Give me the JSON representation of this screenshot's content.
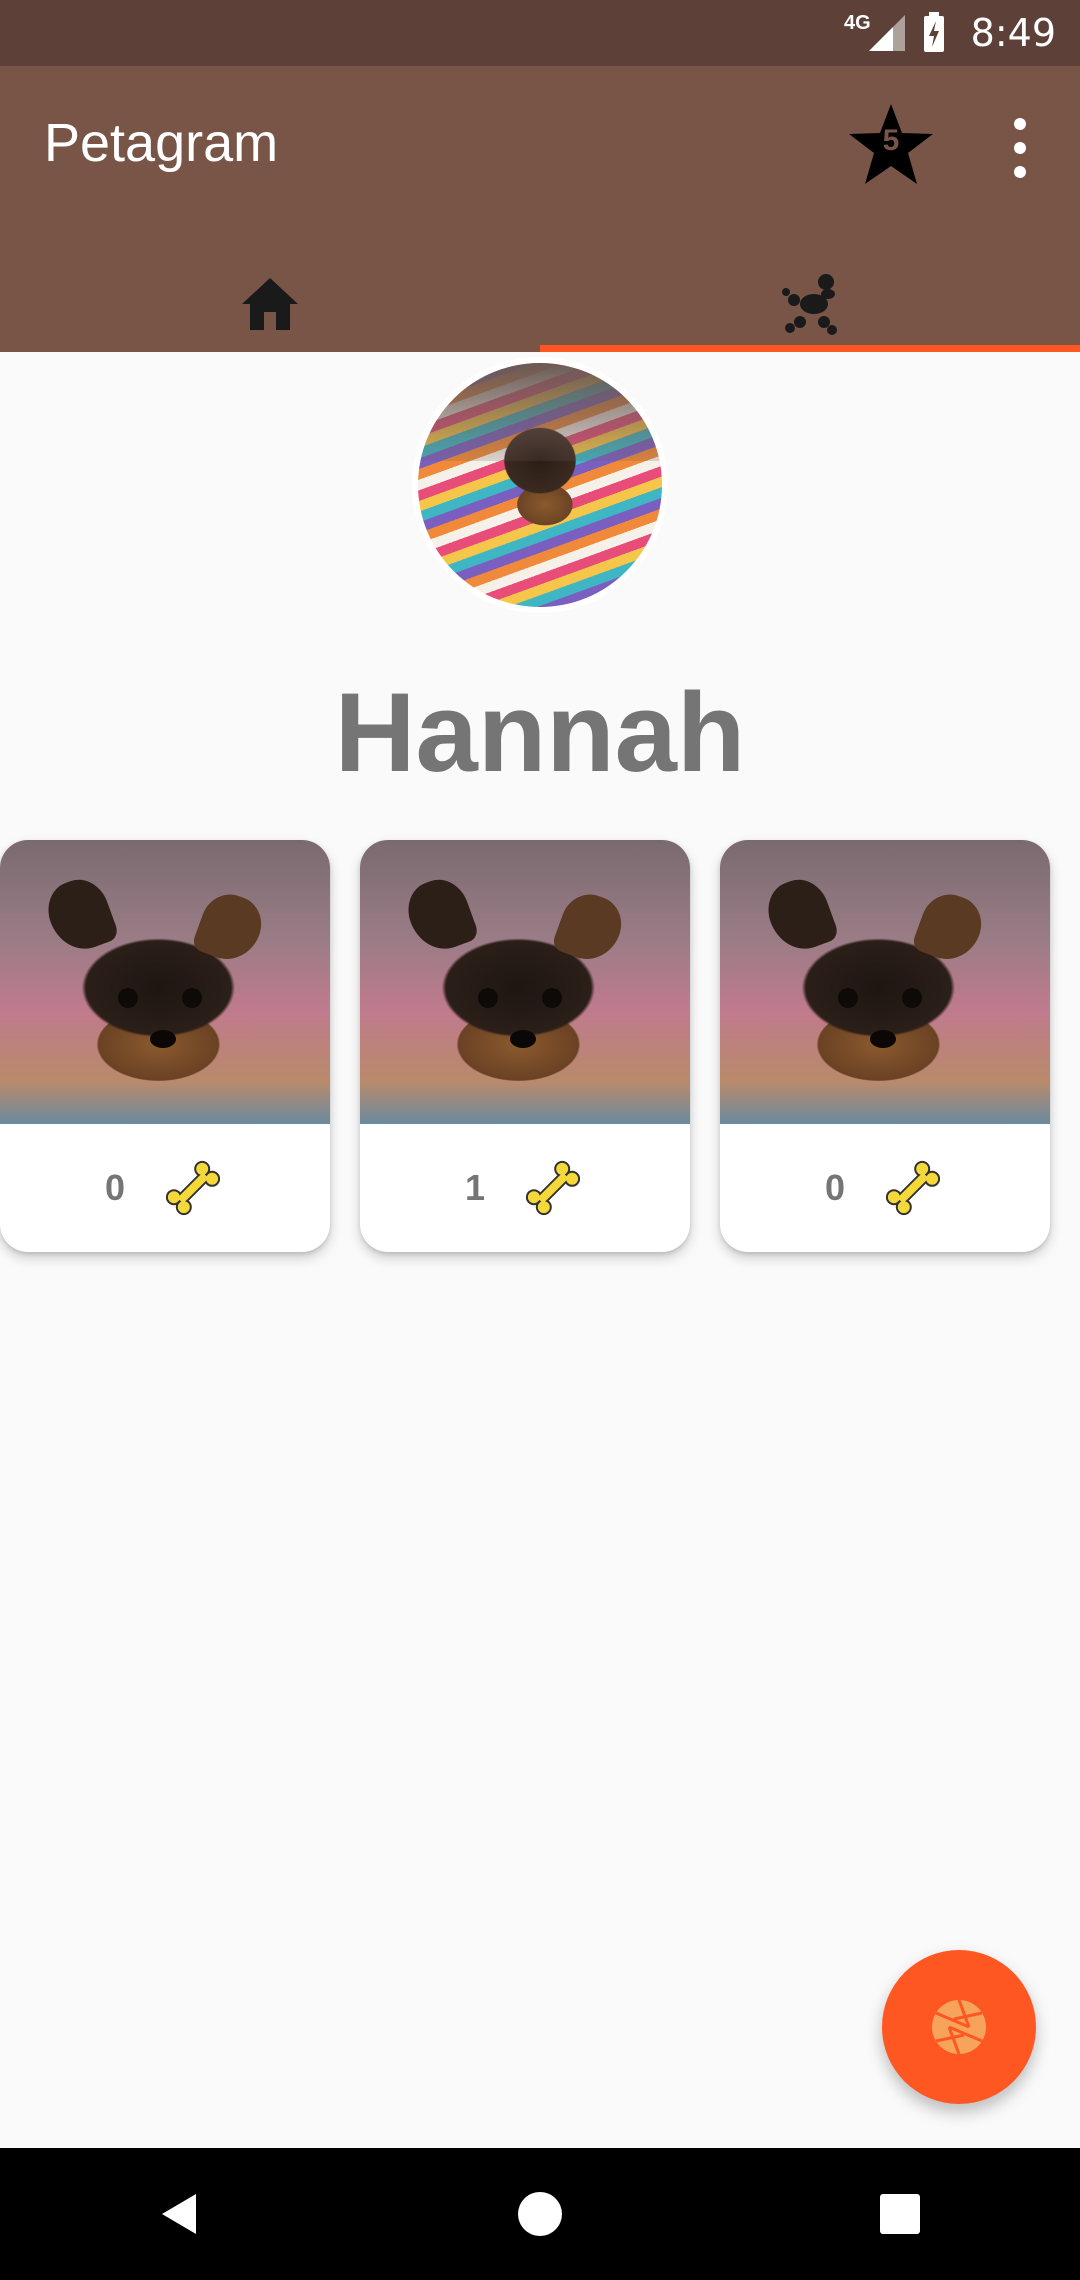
{
  "status_bar": {
    "network": "4G",
    "time": "8:49"
  },
  "app_bar": {
    "title": "Petagram",
    "favorites_count": "5",
    "overflow_icon": "more-vert-icon"
  },
  "tabs": [
    {
      "name": "home",
      "icon": "home-icon",
      "selected": false
    },
    {
      "name": "profile",
      "icon": "poodle-icon",
      "selected": true
    }
  ],
  "profile": {
    "name": "Hannah"
  },
  "pets": [
    {
      "likes": "0",
      "icon": "bone-icon"
    },
    {
      "likes": "1",
      "icon": "bone-icon"
    },
    {
      "likes": "0",
      "icon": "bone-icon"
    }
  ],
  "fab": {
    "icon": "camera-shutter-icon"
  },
  "colors": {
    "status_bar": "#5d4037",
    "primary": "#795548",
    "accent": "#ff5722",
    "text_secondary": "#757575",
    "bone": "#f5d93b"
  }
}
